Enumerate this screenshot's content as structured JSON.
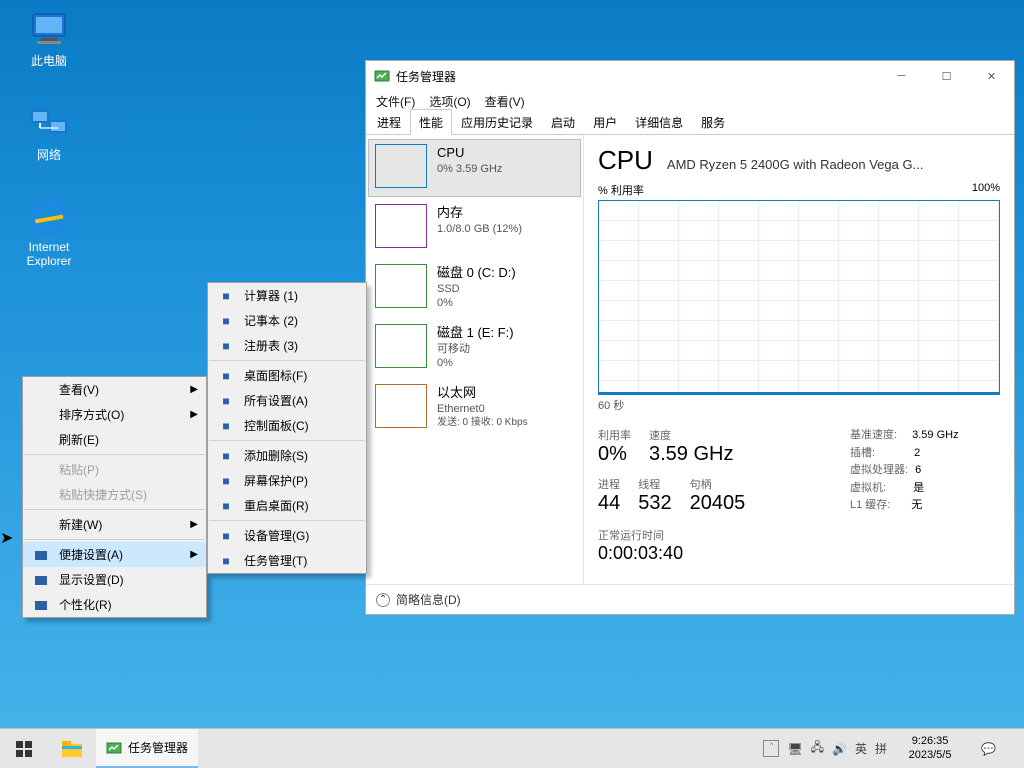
{
  "desktop": {
    "icons": [
      {
        "label": "此电脑"
      },
      {
        "label": "网络"
      },
      {
        "label": "Internet Explorer"
      }
    ]
  },
  "context_menu_1": {
    "items": [
      {
        "label": "查看(V)",
        "arrow": true
      },
      {
        "label": "排序方式(O)",
        "arrow": true
      },
      {
        "label": "刷新(E)"
      },
      {
        "sep": true
      },
      {
        "label": "粘贴(P)",
        "disabled": true
      },
      {
        "label": "粘贴快捷方式(S)",
        "disabled": true
      },
      {
        "sep": true
      },
      {
        "label": "新建(W)",
        "arrow": true
      },
      {
        "sep": true
      },
      {
        "label": "便捷设置(A)",
        "arrow": true,
        "hover": true
      },
      {
        "label": "显示设置(D)"
      },
      {
        "label": "个性化(R)"
      }
    ]
  },
  "context_menu_2": {
    "items": [
      {
        "label": "计算器  (1)"
      },
      {
        "label": "记事本  (2)"
      },
      {
        "label": "注册表  (3)"
      },
      {
        "sep": true
      },
      {
        "label": "桌面图标(F)"
      },
      {
        "label": "所有设置(A)"
      },
      {
        "label": "控制面板(C)"
      },
      {
        "sep": true
      },
      {
        "label": "添加删除(S)"
      },
      {
        "label": "屏幕保护(P)"
      },
      {
        "label": "重启桌面(R)"
      },
      {
        "sep": true
      },
      {
        "label": "设备管理(G)"
      },
      {
        "label": "任务管理(T)"
      }
    ]
  },
  "taskmgr": {
    "title": "任务管理器",
    "menubar": [
      "文件(F)",
      "选项(O)",
      "查看(V)"
    ],
    "tabs": [
      "进程",
      "性能",
      "应用历史记录",
      "启动",
      "用户",
      "详细信息",
      "服务"
    ],
    "active_tab": 1,
    "left": [
      {
        "title": "CPU",
        "sub": "0% 3.59 GHz",
        "color": "#117dbb",
        "selected": true
      },
      {
        "title": "内存",
        "sub": "1.0/8.0 GB (12%)",
        "color": "#8a2da5"
      },
      {
        "title": "磁盘 0 (C: D:)",
        "sub1": "SSD",
        "sub2": "0%",
        "color": "#3a8f3a"
      },
      {
        "title": "磁盘 1 (E: F:)",
        "sub1": "可移动",
        "sub2": "0%",
        "color": "#3a8f3a"
      },
      {
        "title": "以太网",
        "sub1": "Ethernet0",
        "sub2": "发送: 0 接收: 0 Kbps",
        "color": "#b06a2f"
      }
    ],
    "right": {
      "heading": "CPU",
      "sub_heading": "AMD Ryzen 5 2400G with Radeon Vega G...",
      "y_label": "% 利用率",
      "y_max": "100%",
      "x_label": "60 秒",
      "row1": {
        "l_util": "利用率",
        "v_util": "0%",
        "l_speed": "速度",
        "v_speed": "3.59 GHz",
        "l_base": "基准速度:",
        "v_base": "3.59 GHz",
        "l_sock": "插槽:",
        "v_sock": "2"
      },
      "row2": {
        "l_proc": "进程",
        "v_proc": "44",
        "l_thread": "线程",
        "v_thread": "532",
        "l_handle": "句柄",
        "v_handle": "20405",
        "l_vp": "虚拟处理器:",
        "v_vp": "6",
        "l_vm": "虚拟机:",
        "v_vm": "是",
        "l_l1": "L1 缓存:",
        "v_l1": "无"
      },
      "uptime_label": "正常运行时间",
      "uptime_value": "0:00:03:40"
    },
    "footer": "简略信息(D)"
  },
  "taskbar": {
    "task_label": "任务管理器",
    "ime1": "英",
    "ime2": "拼",
    "time": "9:26:35",
    "date": "2023/5/5"
  },
  "chart_data": {
    "type": "line",
    "title": "CPU % 利用率",
    "xlabel": "60 秒",
    "ylabel": "% 利用率",
    "ylim": [
      0,
      100
    ],
    "x": [
      60,
      55,
      50,
      45,
      40,
      35,
      30,
      25,
      20,
      15,
      10,
      5,
      0
    ],
    "values": [
      0,
      0,
      0,
      0,
      0,
      0,
      0,
      0,
      0,
      0,
      0,
      0,
      0
    ]
  }
}
